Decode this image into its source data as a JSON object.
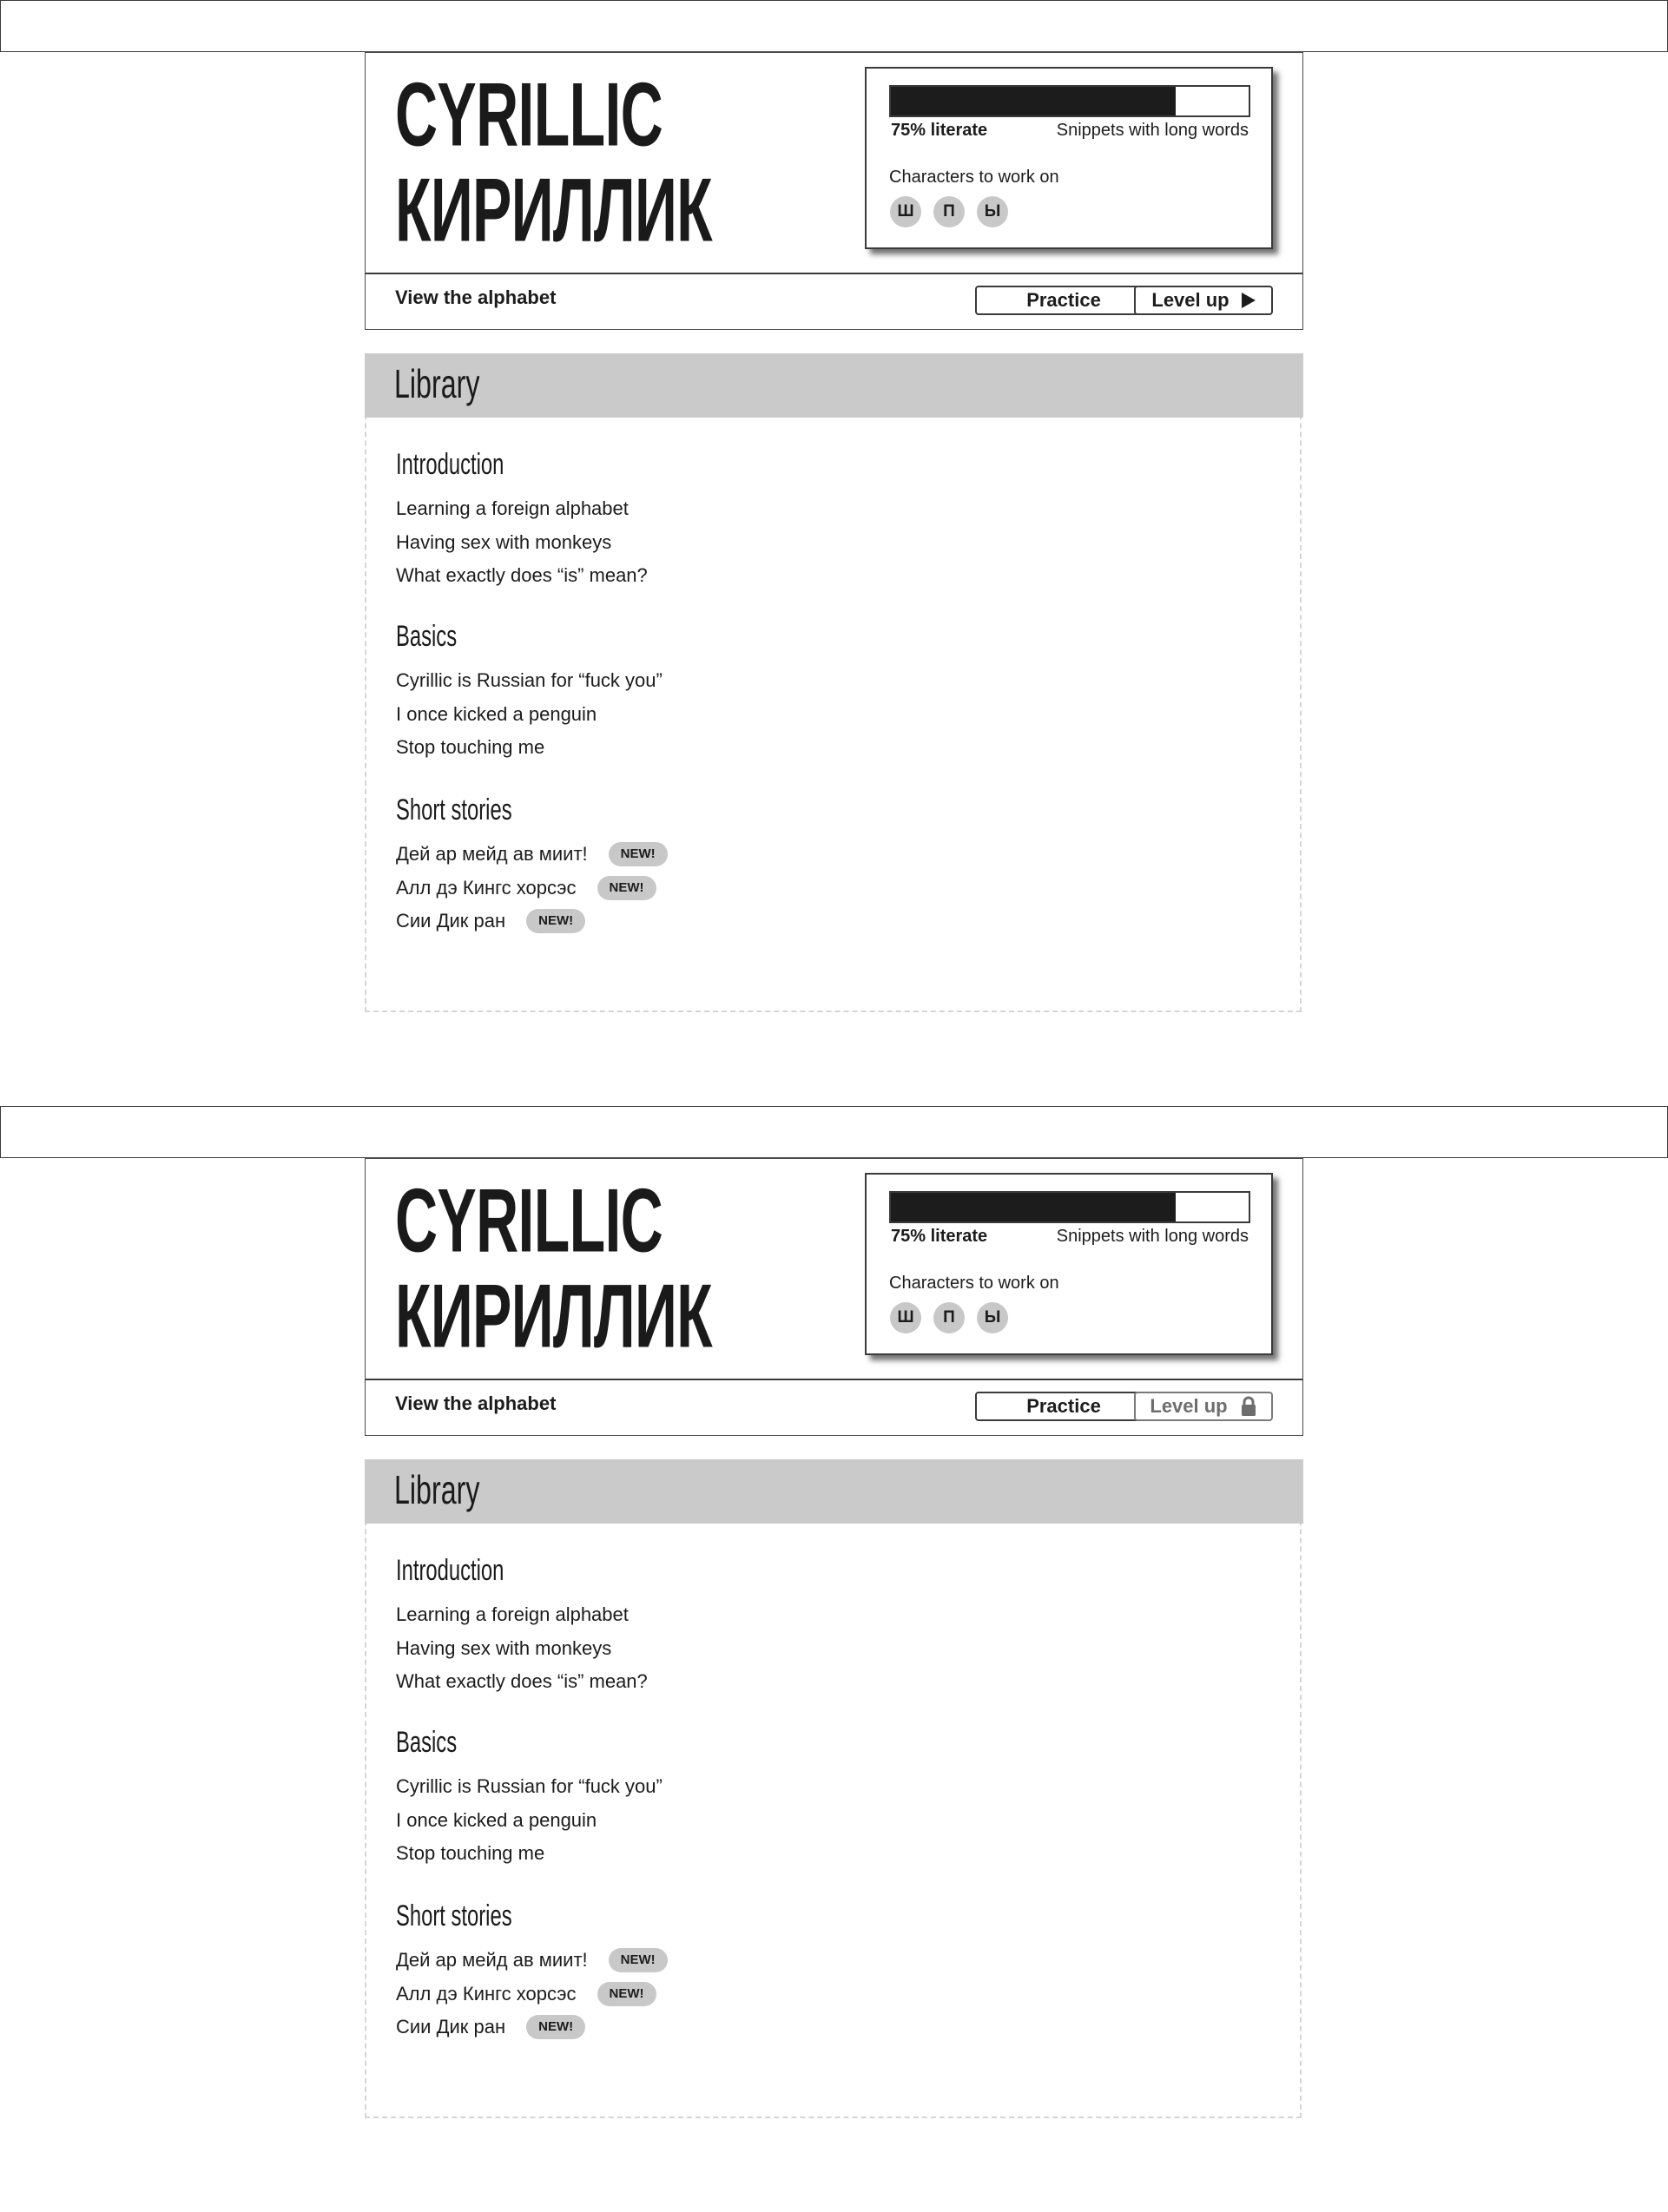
{
  "screens": [
    {
      "logo": {
        "line1": "CYRILLIC",
        "line2": "КИРИЛЛИК"
      },
      "progress": {
        "percent": 79.5,
        "label": "75% literate",
        "snippets_label": "Snippets with long words"
      },
      "work_on": {
        "label": "Characters to work on",
        "chars": [
          "Ш",
          "П",
          "Ы"
        ]
      },
      "nav": {
        "view_alphabet": "View the alphabet",
        "practice": "Practice",
        "level_up": "Level up",
        "level_up_icon": "play-icon",
        "level_up_locked": false
      },
      "library": {
        "title": "Library",
        "sections": [
          {
            "heading": "Introduction",
            "items": [
              {
                "label": "Learning a foreign alphabet"
              },
              {
                "label": "Having sex with monkeys"
              },
              {
                "label": "What exactly does “is” mean?"
              }
            ]
          },
          {
            "heading": "Basics",
            "items": [
              {
                "label": "Cyrillic is Russian for “fuck you”"
              },
              {
                "label": "I once kicked a penguin"
              },
              {
                "label": "Stop touching me"
              }
            ]
          },
          {
            "heading": "Short stories",
            "items": [
              {
                "label": "Дей ар мейд ав миит!",
                "badge": "NEW!"
              },
              {
                "label": "Алл дэ Кингс хорсэс",
                "badge": "NEW!"
              },
              {
                "label": "Сии Дик ран",
                "badge": "NEW!"
              }
            ]
          }
        ]
      }
    },
    {
      "logo": {
        "line1": "CYRILLIC",
        "line2": "КИРИЛЛИК"
      },
      "progress": {
        "percent": 79.5,
        "label": "75% literate",
        "snippets_label": "Snippets with long words"
      },
      "work_on": {
        "label": "Characters to work on",
        "chars": [
          "Ш",
          "П",
          "Ы"
        ]
      },
      "nav": {
        "view_alphabet": "View the alphabet",
        "practice": "Practice",
        "level_up": "Level up",
        "level_up_icon": "lock-icon",
        "level_up_locked": true
      },
      "library": {
        "title": "Library",
        "sections": [
          {
            "heading": "Introduction",
            "items": [
              {
                "label": "Learning a foreign alphabet"
              },
              {
                "label": "Having sex with monkeys"
              },
              {
                "label": "What exactly does “is” mean?"
              }
            ]
          },
          {
            "heading": "Basics",
            "items": [
              {
                "label": "Cyrillic is Russian for “fuck you”"
              },
              {
                "label": "I once kicked a penguin"
              },
              {
                "label": "Stop touching me"
              }
            ]
          },
          {
            "heading": "Short stories",
            "items": [
              {
                "label": "Дей ар мейд ав миит!",
                "badge": "NEW!"
              },
              {
                "label": "Алл дэ Кингс хорсэс",
                "badge": "NEW!"
              },
              {
                "label": "Сии Дик ран",
                "badge": "NEW!"
              }
            ]
          }
        ]
      }
    }
  ]
}
